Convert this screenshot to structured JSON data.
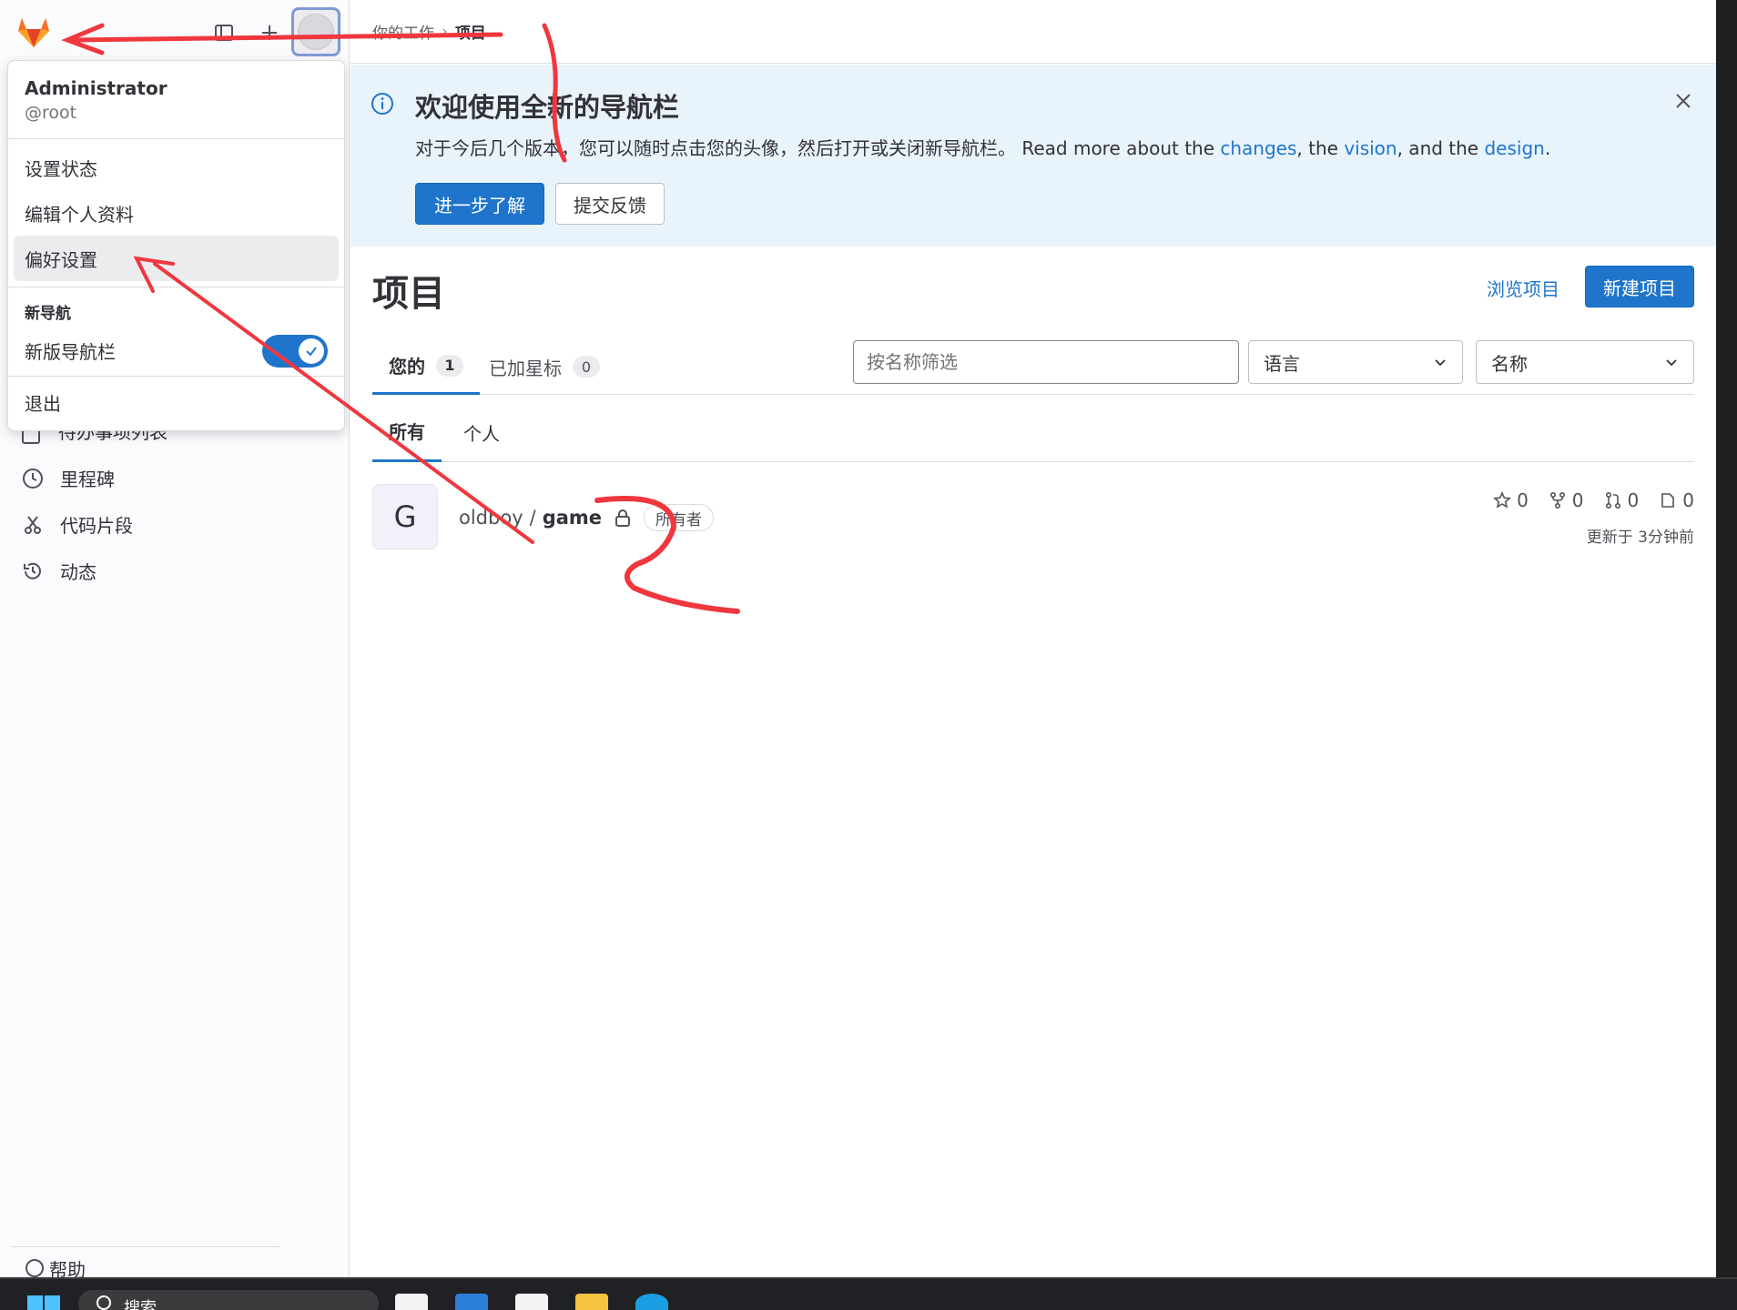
{
  "breadcrumb": {
    "parent": "你的工作",
    "separator": "›",
    "current": "项目"
  },
  "sidebar": {
    "partial_item": "待办事项列表",
    "items": [
      {
        "label": "里程碑",
        "icon": "clock-icon"
      },
      {
        "label": "代码片段",
        "icon": "snippet-icon"
      },
      {
        "label": "动态",
        "icon": "history-icon"
      }
    ],
    "help_label": "帮助"
  },
  "user_menu": {
    "name": "Administrator",
    "handle": "@root",
    "items": [
      "设置状态",
      "编辑个人资料",
      "偏好设置"
    ],
    "section_title": "新导航",
    "toggle_label": "新版导航栏",
    "toggle_on": true,
    "sign_out": "退出"
  },
  "banner": {
    "title": "欢迎使用全新的导航栏",
    "body_prefix": "对于今后几个版本，您可以随时点击您的头像，然后打开或关闭新导航栏。 Read more about the ",
    "link_changes": "changes",
    "body_mid1": ", the ",
    "link_vision": "vision",
    "body_mid2": ", and the ",
    "link_design": "design",
    "body_suffix": ".",
    "primary_button": "进一步了解",
    "secondary_button": "提交反馈"
  },
  "page": {
    "title": "项目",
    "browse_link": "浏览项目",
    "new_button": "新建项目"
  },
  "tabs": [
    {
      "label": "您的",
      "count": "1",
      "active": true
    },
    {
      "label": "已加星标",
      "count": "0",
      "active": false
    }
  ],
  "filter": {
    "placeholder": "按名称筛选",
    "language_select": "语言",
    "sort_select": "名称"
  },
  "subtabs": [
    {
      "label": "所有",
      "active": true
    },
    {
      "label": "个人",
      "active": false
    }
  ],
  "projects": [
    {
      "avatar_letter": "G",
      "namespace": "oldboy",
      "slash": "/",
      "name": "game",
      "role": "所有者",
      "stars": "0",
      "forks": "0",
      "merge_requests": "0",
      "issues": "0",
      "updated": "更新于 3分钟前"
    }
  ],
  "taskbar": {
    "search_label": "搜索"
  },
  "colors": {
    "accent": "#1f75cb",
    "banner_bg": "#e9f3fc",
    "annotation": "#f0373e"
  }
}
